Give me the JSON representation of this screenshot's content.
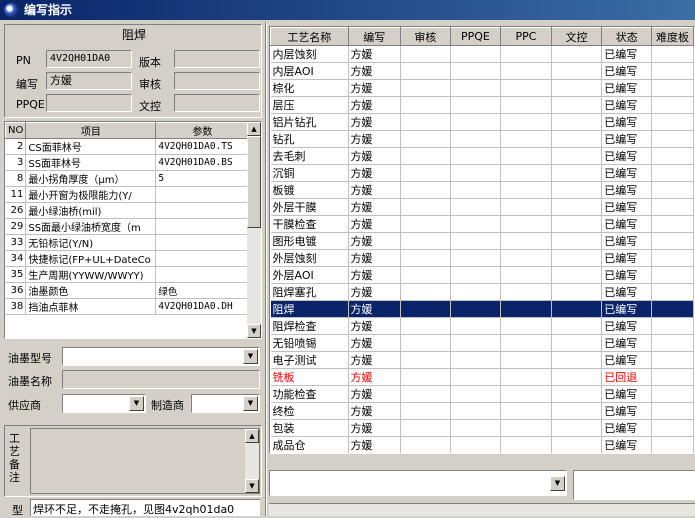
{
  "window": {
    "title": "编写指示"
  },
  "info_panel": {
    "caption": "阻焊",
    "pn_label": "PN",
    "pn_value": "4V2QH01DA0",
    "version_label": "版本",
    "version_value": "",
    "author_label": "编写",
    "author_value": "方媛",
    "review_label": "审核",
    "review_value": "",
    "ppqe_label": "PPQE",
    "ppqe_value": "",
    "wenkong_label": "文控",
    "wenkong_value": ""
  },
  "param_table": {
    "headers": [
      "NO",
      "项目",
      "参数"
    ],
    "rows": [
      {
        "no": "2",
        "item": "CS面菲林号",
        "value": "4V2QH01DA0.TS"
      },
      {
        "no": "3",
        "item": "SS面菲林号",
        "value": "4V2QH01DA0.BS"
      },
      {
        "no": "8",
        "item": "最小拐角厚度（μm）",
        "value": "5"
      },
      {
        "no": "11",
        "item": "最小开窗为极限能力(Y/",
        "value": ""
      },
      {
        "no": "26",
        "item": "最小绿油桥(mil)",
        "value": ""
      },
      {
        "no": "29",
        "item": "SS面最小绿油桥宽度（m",
        "value": ""
      },
      {
        "no": "33",
        "item": "无铅标记(Y/N)",
        "value": ""
      },
      {
        "no": "34",
        "item": "快捷标记(FP+UL+DateCo",
        "value": ""
      },
      {
        "no": "35",
        "item": "生产周期(YYWW/WWYY)",
        "value": ""
      },
      {
        "no": "36",
        "item": "油墨颜色",
        "value": "绿色"
      },
      {
        "no": "38",
        "item": "挡油点菲林",
        "value": "4V2QH01DA0.DH"
      }
    ]
  },
  "ink": {
    "model_label": "油墨型号",
    "model_value": "",
    "name_label": "油墨名称",
    "name_value": "",
    "supplier_label": "供应商",
    "supplier_value": "",
    "maker_label": "制造商",
    "maker_value": ""
  },
  "remark": {
    "label": "工艺备注",
    "value": ""
  },
  "bottom": {
    "label": "型",
    "value": "焊环不足，不走掩孔，见图4v2qh01da0"
  },
  "process_table": {
    "headers": [
      "工艺名称",
      "编写",
      "审核",
      "PPQE",
      "PPC",
      "文控",
      "状态",
      "难度板"
    ],
    "rows": [
      {
        "name": "内层蚀刻",
        "author": "方媛",
        "status": "已编写"
      },
      {
        "name": "内层AOI",
        "author": "方媛",
        "status": "已编写"
      },
      {
        "name": "棕化",
        "author": "方媛",
        "status": "已编写"
      },
      {
        "name": "层压",
        "author": "方媛",
        "status": "已编写"
      },
      {
        "name": "铝片钻孔",
        "author": "方媛",
        "status": "已编写"
      },
      {
        "name": "钻孔",
        "author": "方媛",
        "status": "已编写"
      },
      {
        "name": "去毛刺",
        "author": "方媛",
        "status": "已编写"
      },
      {
        "name": "沉铜",
        "author": "方媛",
        "status": "已编写"
      },
      {
        "name": "板镀",
        "author": "方媛",
        "status": "已编写"
      },
      {
        "name": "外层干膜",
        "author": "方媛",
        "status": "已编写"
      },
      {
        "name": "干膜检查",
        "author": "方媛",
        "status": "已编写"
      },
      {
        "name": "图形电镀",
        "author": "方媛",
        "status": "已编写"
      },
      {
        "name": "外层蚀刻",
        "author": "方媛",
        "status": "已编写"
      },
      {
        "name": "外层AOI",
        "author": "方媛",
        "status": "已编写"
      },
      {
        "name": "阻焊塞孔",
        "author": "方媛",
        "status": "已编写"
      },
      {
        "name": "阻焊",
        "author": "方媛",
        "status": "已编写",
        "selected": true
      },
      {
        "name": "阻焊检查",
        "author": "方媛",
        "status": "已编写"
      },
      {
        "name": "无铅喷锡",
        "author": "方媛",
        "status": "已编写"
      },
      {
        "name": "电子测试",
        "author": "方媛",
        "status": "已编写"
      },
      {
        "name": "铣板",
        "author": "方媛",
        "status": "已回退",
        "red": true
      },
      {
        "name": "功能检查",
        "author": "方媛",
        "status": "已编写"
      },
      {
        "name": "终检",
        "author": "方媛",
        "status": "已编写"
      },
      {
        "name": "包装",
        "author": "方媛",
        "status": "已编写"
      },
      {
        "name": "成品仓",
        "author": "方媛",
        "status": "已编写"
      }
    ]
  },
  "right_bottom": {
    "combo_value": "",
    "text_value": ""
  },
  "colors": {
    "title_bar": "#0a246a",
    "selection": "#0a246a",
    "rolled_back": "#ff0000",
    "face": "#d4d0c8"
  }
}
